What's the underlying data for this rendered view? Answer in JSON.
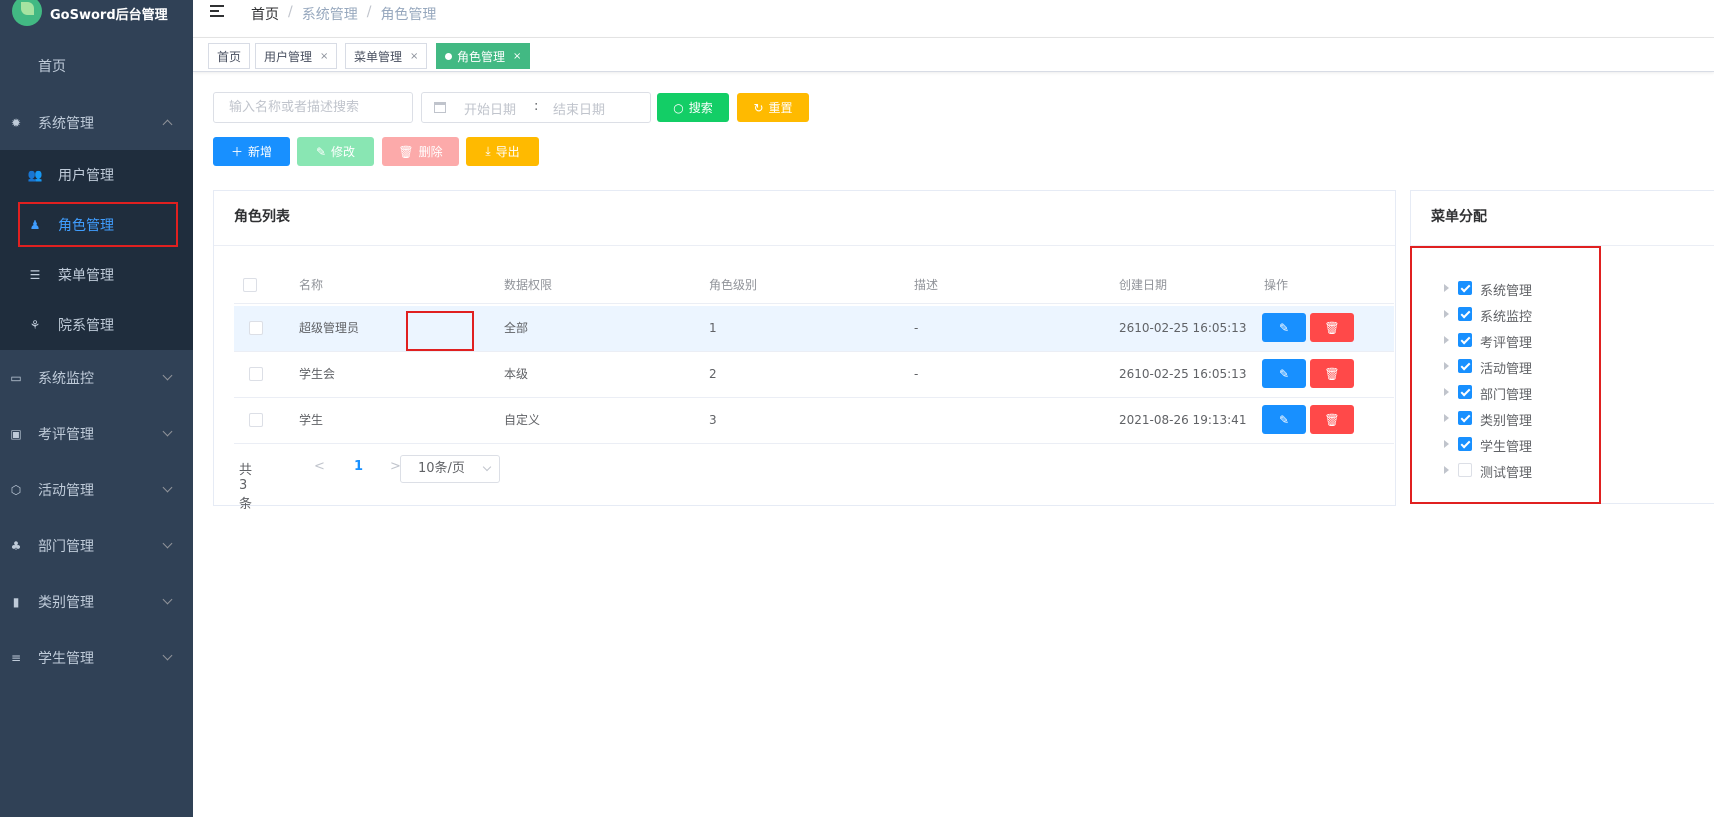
{
  "app": {
    "title": "GoSword后台管理"
  },
  "sidebar": {
    "home": "首页",
    "system": "系统管理",
    "sub": [
      {
        "label": "用户管理"
      },
      {
        "label": "角色管理"
      },
      {
        "label": "菜单管理"
      },
      {
        "label": "院系管理"
      }
    ],
    "groups": [
      {
        "label": "系统监控"
      },
      {
        "label": "考评管理"
      },
      {
        "label": "活动管理"
      },
      {
        "label": "部门管理"
      },
      {
        "label": "类别管理"
      },
      {
        "label": "学生管理"
      }
    ]
  },
  "breadcrumb": [
    "首页",
    "系统管理",
    "角色管理"
  ],
  "tags": [
    {
      "label": "首页"
    },
    {
      "label": "用户管理",
      "close": "×"
    },
    {
      "label": "菜单管理",
      "close": "×"
    },
    {
      "label": "角色管理",
      "close": "×"
    }
  ],
  "toolbar": {
    "search_placeholder": "输入名称或者描述搜索",
    "date_start": "开始日期",
    "date_sep": ":",
    "date_end": "结束日期",
    "search": "搜索",
    "reset": "重置",
    "add": "新增",
    "edit": "修改",
    "delete": "删除",
    "export": "导出"
  },
  "role_list": {
    "title": "角色列表",
    "columns": [
      "名称",
      "数据权限",
      "角色级别",
      "描述",
      "创建日期",
      "操作"
    ],
    "rows": [
      {
        "name": "超级管理员",
        "scope": "全部",
        "level": "1",
        "desc": "-",
        "created": "2610-02-25 16:05:13"
      },
      {
        "name": "学生会",
        "scope": "本级",
        "level": "2",
        "desc": "-",
        "created": "2610-02-25 16:05:13"
      },
      {
        "name": "学生",
        "scope": "自定义",
        "level": "3",
        "desc": "",
        "created": "2021-08-26 19:13:41"
      }
    ],
    "pagination": {
      "total": "共 3 条",
      "prev": "<",
      "page": "1",
      "next": ">",
      "page_size": "10条/页"
    }
  },
  "menu_assign": {
    "title": "菜单分配",
    "nodes": [
      {
        "label": "系统管理",
        "checked": true
      },
      {
        "label": "系统监控",
        "checked": true
      },
      {
        "label": "考评管理",
        "checked": true
      },
      {
        "label": "活动管理",
        "checked": true
      },
      {
        "label": "部门管理",
        "checked": true
      },
      {
        "label": "类别管理",
        "checked": true
      },
      {
        "label": "学生管理",
        "checked": true
      },
      {
        "label": "测试管理",
        "checked": false
      }
    ]
  },
  "colors": {
    "sidebar_bg": "#304156",
    "submenu_bg": "#1f2d3d",
    "active": "#409eff",
    "tag_active": "#42b983",
    "highlight_box": "#e02020"
  }
}
